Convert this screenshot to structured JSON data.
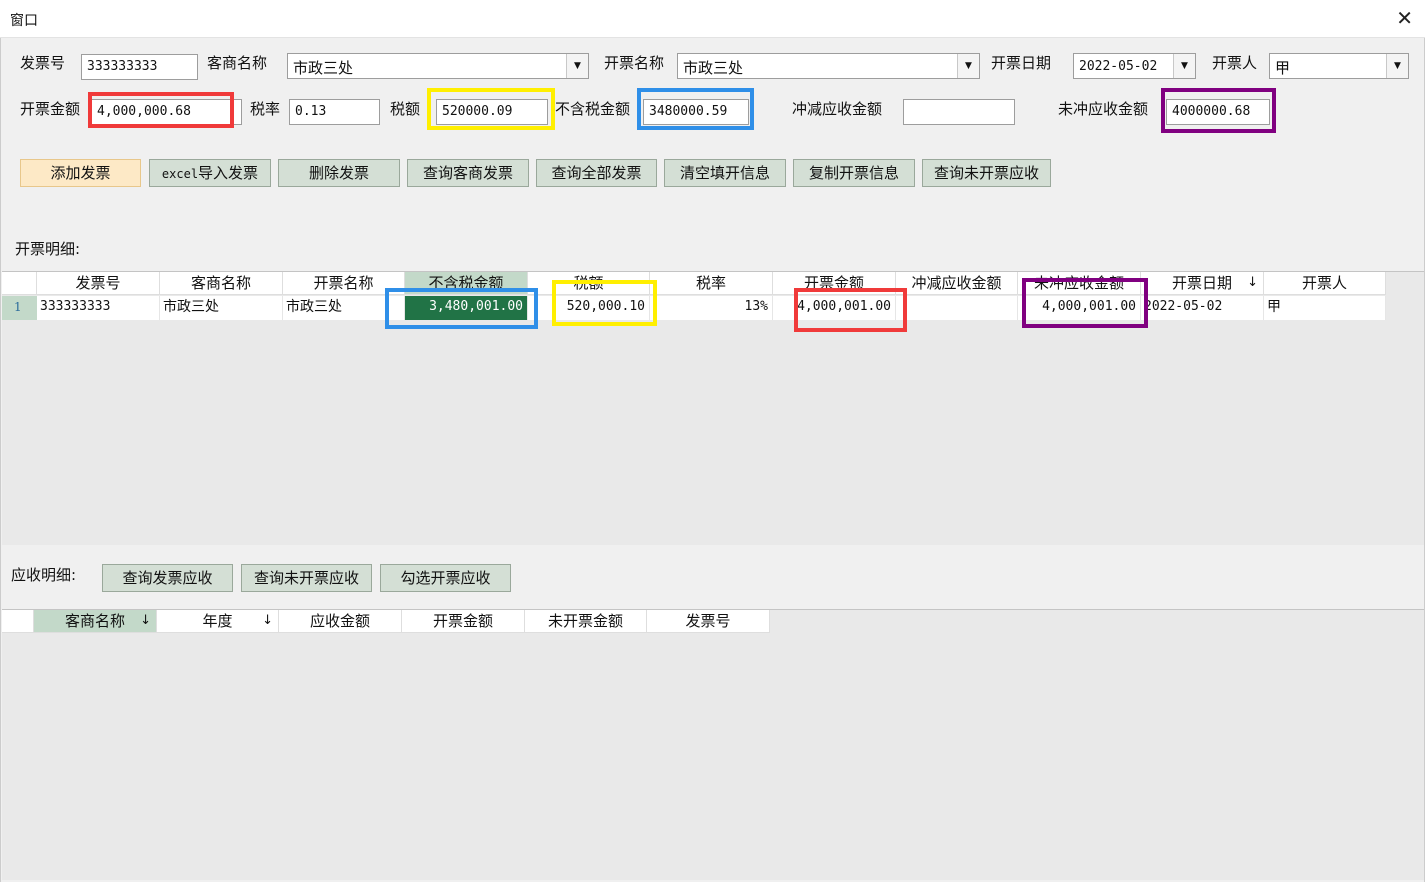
{
  "window": {
    "title": "窗口",
    "close_glyph": "✕"
  },
  "form": {
    "invoice_no_label": "发票号",
    "invoice_no": "333333333",
    "customer_label": "客商名称",
    "customer": "市政三处",
    "invoice_name_label": "开票名称",
    "invoice_name": "市政三处",
    "invoice_date_label": "开票日期",
    "invoice_date": "2022-05-02",
    "issuer_label": "开票人",
    "issuer": "甲",
    "amount_label": "开票金额",
    "amount": "4,000,000.68",
    "tax_rate_label": "税率",
    "tax_rate": "0.13",
    "tax_label": "税额",
    "tax": "520000.09",
    "net_label": "不含税金额",
    "net": "3480000.59",
    "offset_label": "冲减应收金额",
    "offset": "",
    "unoffset_label": "未冲应收金额",
    "unoffset": "4000000.68"
  },
  "toolbar": {
    "add": "添加发票",
    "excel_prefix": "excel",
    "excel_suffix": "导入发票",
    "delete": "删除发票",
    "query_customer": "查询客商发票",
    "query_all": "查询全部发票",
    "clear": "清空填开信息",
    "copy": "复制开票信息",
    "query_unbilled": "查询未开票应收"
  },
  "detail": {
    "label": "开票明细:",
    "columns": [
      "发票号",
      "客商名称",
      "开票名称",
      "不含税金额",
      "税额",
      "税率",
      "开票金额",
      "冲减应收金额",
      "未冲应收金额",
      "开票日期",
      "开票人"
    ],
    "sort_glyph": "↓",
    "rows": [
      {
        "index": "1",
        "invoice_no": "333333333",
        "customer": "市政三处",
        "invoice_name": "市政三处",
        "net": "3,480,001.00",
        "tax": "520,000.10",
        "rate": "13%",
        "amount": "4,000,001.00",
        "offset": "",
        "unoffset": "4,000,001.00",
        "date": "2022-05-02",
        "issuer": "甲"
      }
    ]
  },
  "receivable": {
    "label": "应收明细:",
    "buttons": {
      "query_invoice": "查询发票应收",
      "query_unbilled": "查询未开票应收",
      "select_unbilled": "勾选开票应收"
    },
    "columns": [
      "客商名称",
      "年度",
      "应收金额",
      "开票金额",
      "未开票金额",
      "发票号"
    ],
    "sort_glyph": "↓"
  },
  "highlight_colors": {
    "red": "#f03a3a",
    "yellow": "#ffef00",
    "blue": "#2f8fe8",
    "purple": "#800080"
  }
}
